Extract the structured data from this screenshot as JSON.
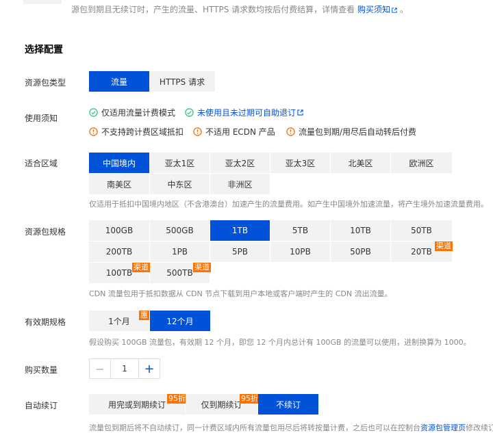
{
  "header": {
    "note_prefix": "源包到期且无续订时，产生的流量、HTTPS 请求数均按后付费结算，详情查看",
    "note_link": "购买须知",
    "note_suffix": "。"
  },
  "section_title": "选择配置",
  "resource_type": {
    "label": "资源包类型",
    "options": [
      "流量",
      "HTTPS 请求"
    ],
    "selected": "流量"
  },
  "usage_notes": {
    "label": "使用须知",
    "items": [
      {
        "text": "仅适用流量计费模式",
        "icon": "check-circle-icon"
      },
      {
        "text": "未使用且未过期可自助退订",
        "icon": "check-circle-icon"
      },
      {
        "text": "不支持跨计费区域抵扣",
        "icon": "warning-circle-icon"
      },
      {
        "text": "不适用 ECDN 产品",
        "icon": "warning-circle-icon"
      },
      {
        "text": "流量包到期/用尽后自动转后付费",
        "icon": "warning-circle-icon"
      }
    ]
  },
  "region": {
    "label": "适合区域",
    "options": [
      "中国境内",
      "亚太1区",
      "亚太2区",
      "亚太3区",
      "北美区",
      "欧洲区",
      "南美区",
      "中东区",
      "非洲区"
    ],
    "selected": "中国境内",
    "hint": "仅适用于抵扣中国境内地区（不含港澳台）加速产生的流量费用。如产生中国境外加速流量，将产生境外加速流量费用。"
  },
  "spec": {
    "label": "资源包规格",
    "options": [
      "100GB",
      "500GB",
      "1TB",
      "5TB",
      "10TB",
      "50TB",
      "200TB",
      "1PB",
      "5PB",
      "10PB",
      "50PB",
      "20TB",
      "100TB",
      "500TB"
    ],
    "selected": "1TB",
    "badge_text": "渠道",
    "hint": "CDN 流量包用于抵扣数据从 CDN 节点下载到用户本地或客户端时产生的 CDN 流出流量。"
  },
  "validity": {
    "label": "有效期规格",
    "options": [
      "1个月",
      "12个月"
    ],
    "selected": "12个月",
    "badge_text": "惠",
    "hint": "假设购买 100GB 流量包，有效期 12 个月，即您 12 个月内总计有 100GB 的流量可以使用，进制换算为 1000。"
  },
  "quantity": {
    "label": "购买数量",
    "value": "1",
    "minus": "−",
    "plus": "+"
  },
  "renewal": {
    "label": "自动续订",
    "options": [
      "用完或到期续订",
      "仅到期续订",
      "不续订"
    ],
    "selected": "不续订",
    "badge_text": "95折",
    "hint_prefix": "流量包到期后将不自动续订，同一计费区域内所有流量包用尽后将转按量计费，之后也可以在控制台",
    "hint_link": "资源包管理页",
    "hint_suffix": "修改续订设置"
  },
  "colors": {
    "accent": "#0052d9",
    "success": "#29cc85",
    "warning": "#ff7200"
  }
}
